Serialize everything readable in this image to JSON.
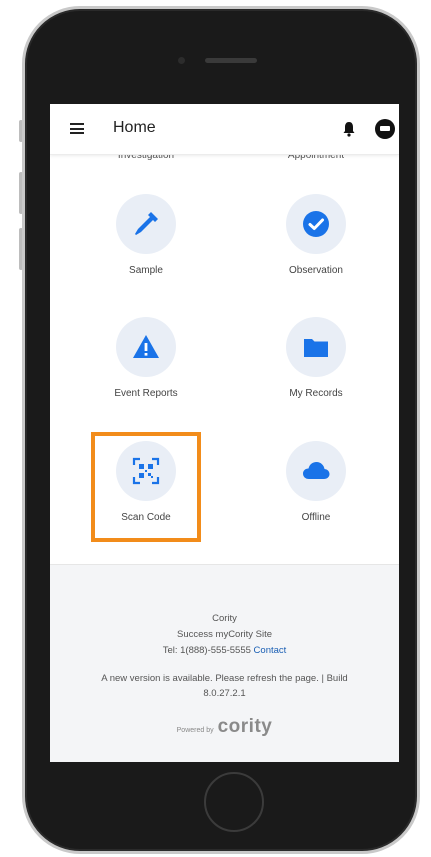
{
  "appbar": {
    "title": "Home",
    "icons": [
      "menu-icon",
      "bell-icon",
      "avatar-icon"
    ]
  },
  "partial_tiles": [
    "Investigation",
    "Appointment"
  ],
  "tiles": [
    {
      "label": "Sample",
      "icon": "dropper-icon"
    },
    {
      "label": "Observation",
      "icon": "check-circle-icon"
    },
    {
      "label": "Event Reports",
      "icon": "warning-icon"
    },
    {
      "label": "My Records",
      "icon": "folder-icon"
    },
    {
      "label": "Scan Code",
      "icon": "qr-scan-icon"
    },
    {
      "label": "Offline",
      "icon": "cloud-icon"
    }
  ],
  "colors": {
    "accent": "#1a73e8",
    "icon_circle_bg": "#e9eef6",
    "highlight": "#f28c1a",
    "footer_bg": "#f4f5f7"
  },
  "footer": {
    "company": "Cority",
    "site": "Success myCority Site",
    "tel_text": "Tel: 1(888)-555-5555",
    "contact_label": "Contact",
    "update_notice": "A new version is available. Please refresh the page. | Build",
    "build": "8.0.27.2.1",
    "powered_by": "Powered by",
    "brand": "cority"
  }
}
